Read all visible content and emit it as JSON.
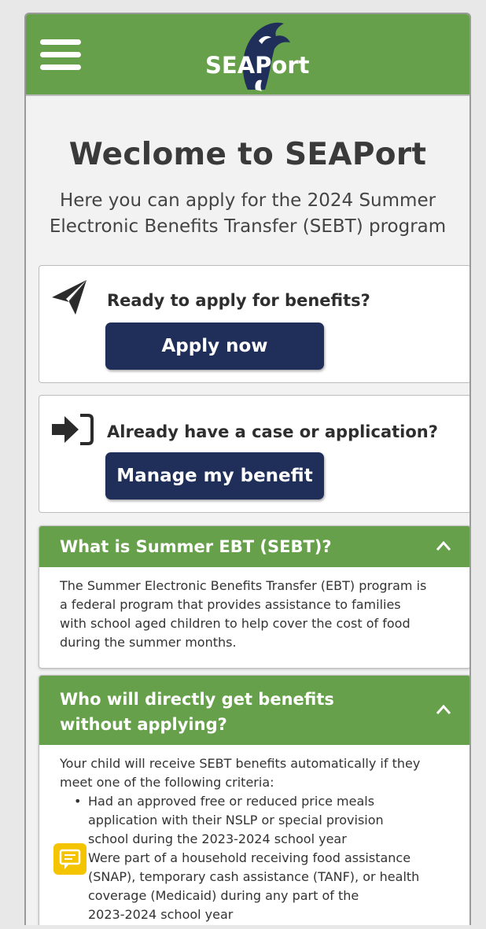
{
  "header": {
    "menu_icon": "hamburger-menu-icon",
    "logo_text": "SEAPort",
    "logo_icon": "orca-whale-icon",
    "brand_color": "#67a04a"
  },
  "hero": {
    "title": "Weclome to SEAPort",
    "subtitle_line1": "Here you can apply for the 2024 Summer",
    "subtitle_line2": "Electronic Benefits Transfer (SEBT) program"
  },
  "apply_card": {
    "icon": "paper-plane-icon",
    "prompt": "Ready to apply for benefits?",
    "button_label": "Apply now"
  },
  "manage_card": {
    "icon": "sign-in-icon",
    "prompt": "Already have a case or application?",
    "button_label": "Manage my benefit"
  },
  "accordion": [
    {
      "title": "What is Summer EBT (SEBT)?",
      "expanded": true,
      "body_lines": [
        "The Summer Electronic Benefits Transfer (EBT) program is",
        "a federal program that provides assistance to families",
        "with school aged children to help cover the cost of food",
        "during the summer months."
      ]
    },
    {
      "title_line1": "Who will directly get benefits",
      "title_line2": "without applying?",
      "expanded": true,
      "intro_lines": [
        "Your child will receive SEBT benefits automatically if they",
        "meet one of the following criteria:"
      ],
      "bullets": [
        {
          "lines": [
            "Had an approved free or reduced price meals",
            "application with their NSLP or special provision",
            "school during the 2023-2024 school year"
          ]
        },
        {
          "lines": [
            "Were part of a household receiving food assistance",
            "(SNAP), temporary cash assistance (TANF), or health",
            "coverage (Medicaid) during any part of the",
            "2023-2024 school year"
          ]
        }
      ]
    }
  ],
  "feedback_widget": {
    "icon": "feedback-chat-icon",
    "color": "#f4c400"
  }
}
